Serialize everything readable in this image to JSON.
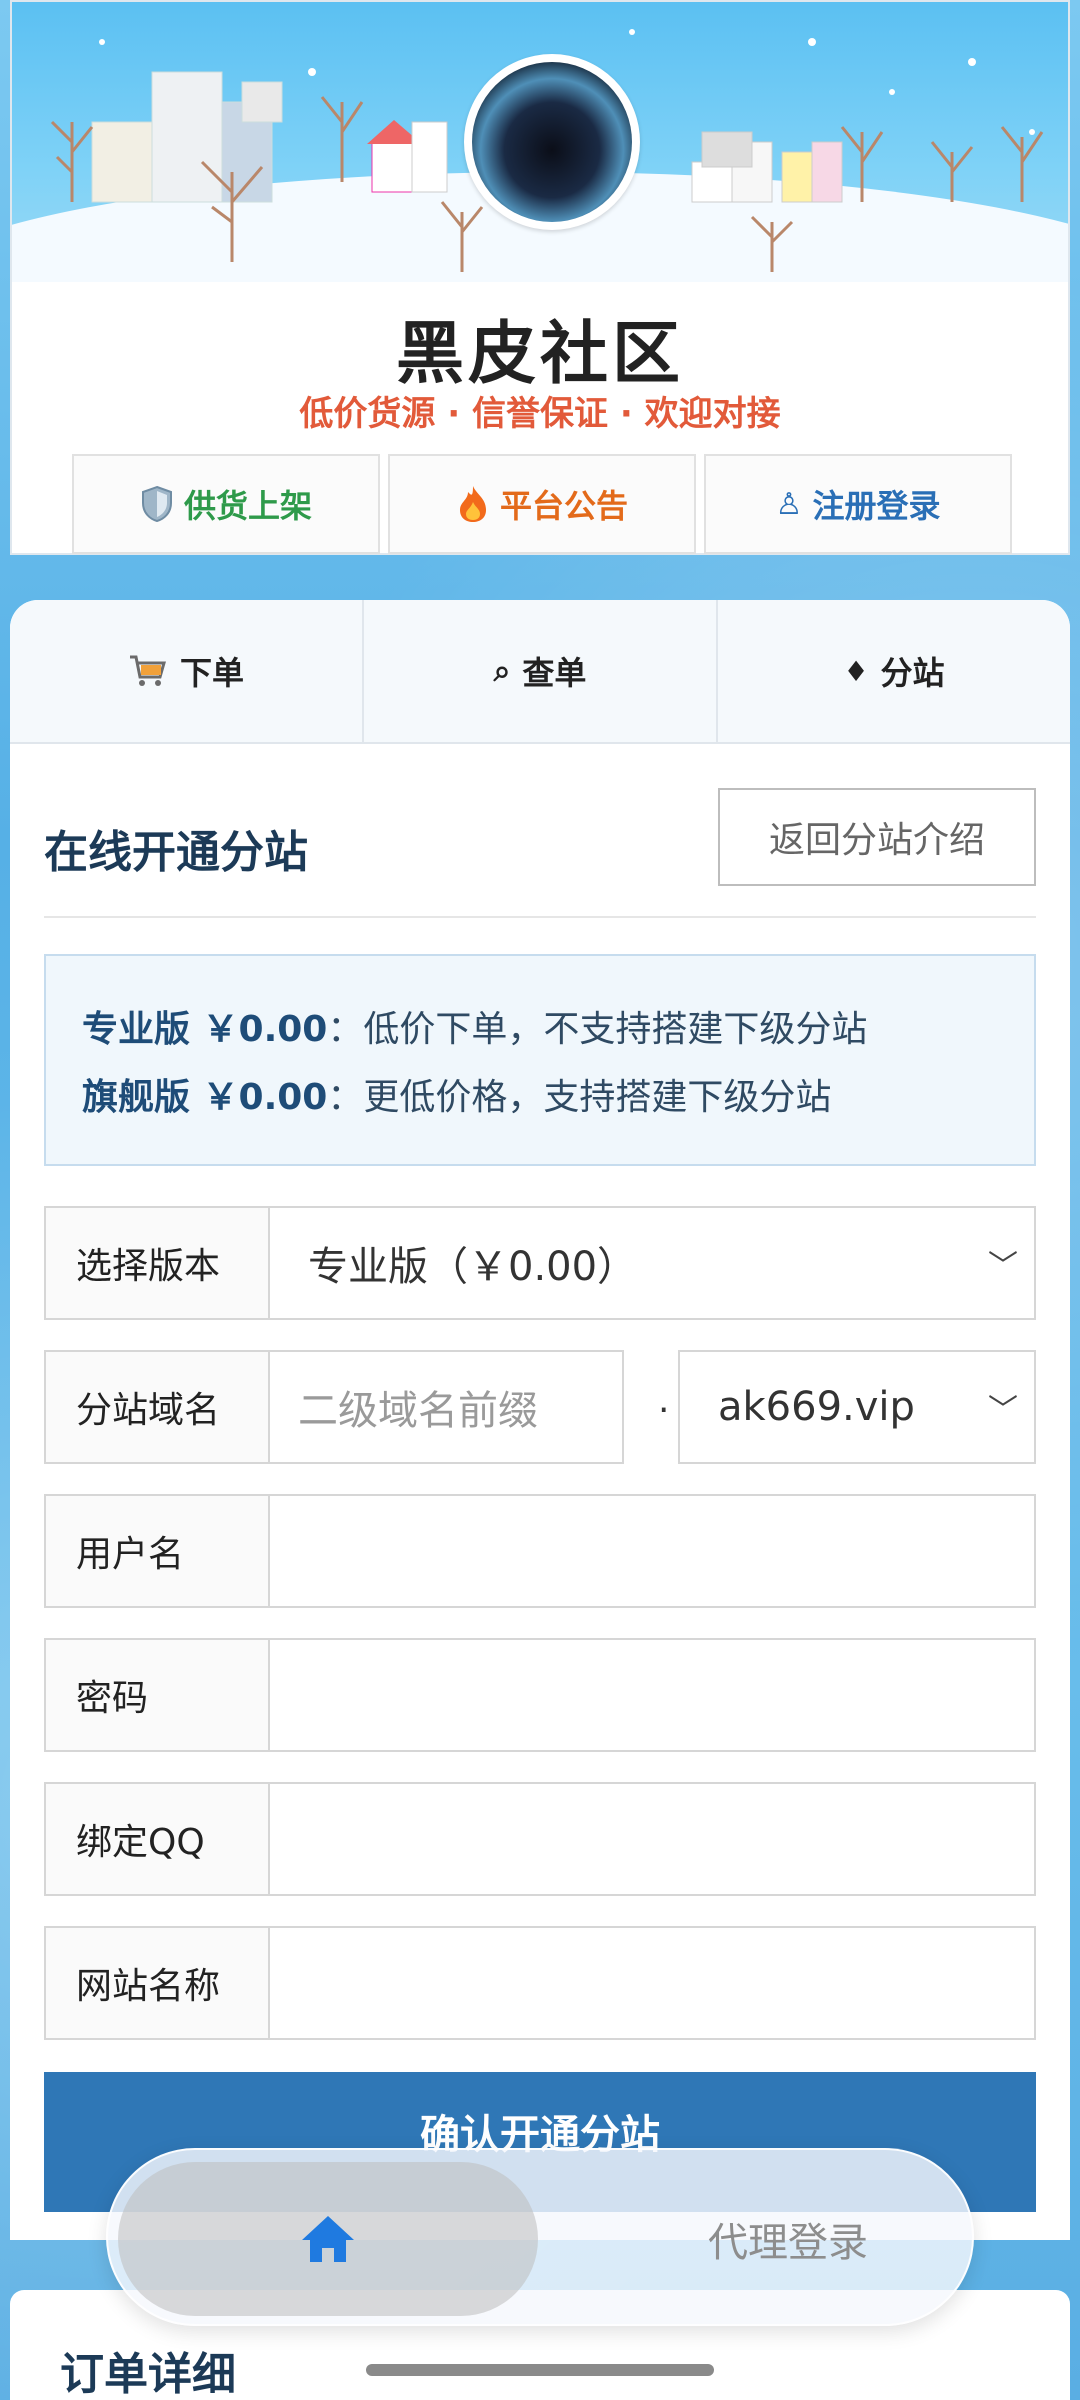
{
  "header": {
    "site_title": "黑皮社区",
    "tagline": "低价货源 · 信誉保证 · 欢迎对接",
    "links": [
      {
        "label": "供货上架",
        "icon": "shield-icon",
        "color": "#2e9a4a"
      },
      {
        "label": "平台公告",
        "icon": "fire-icon",
        "color": "#e36a1a"
      },
      {
        "label": "注册登录",
        "icon": "user-icon",
        "color": "#2a6fb6"
      }
    ]
  },
  "tabs": [
    {
      "label": "下单",
      "icon": "cart-icon"
    },
    {
      "label": "查单",
      "icon": "search-icon"
    },
    {
      "label": "分站",
      "icon": "diamond-icon"
    }
  ],
  "form": {
    "title": "在线开通分站",
    "back_label": "返回分站介绍",
    "info": {
      "pro_name": "专业版 ￥0.00",
      "pro_desc": "：低价下单，不支持搭建下级分站",
      "flag_name": "旗舰版 ￥0.00",
      "flag_desc": "：更低价格，支持搭建下级分站"
    },
    "version_label": "选择版本",
    "version_value": "专业版（￥0.00）",
    "domain_label": "分站域名",
    "domain_placeholder": "二级域名前缀",
    "domain_dot": ".",
    "domain_suffix": "ak669.vip",
    "username_label": "用户名",
    "password_label": "密码",
    "qq_label": "绑定QQ",
    "sitename_label": "网站名称",
    "submit_label": "确认开通分站"
  },
  "nav": {
    "agent_login": "代理登录"
  },
  "order": {
    "title": "订单详细"
  },
  "colors": {
    "accent": "#2f77b6",
    "tagline": "#e25a3a",
    "heading": "#1c3a57"
  }
}
